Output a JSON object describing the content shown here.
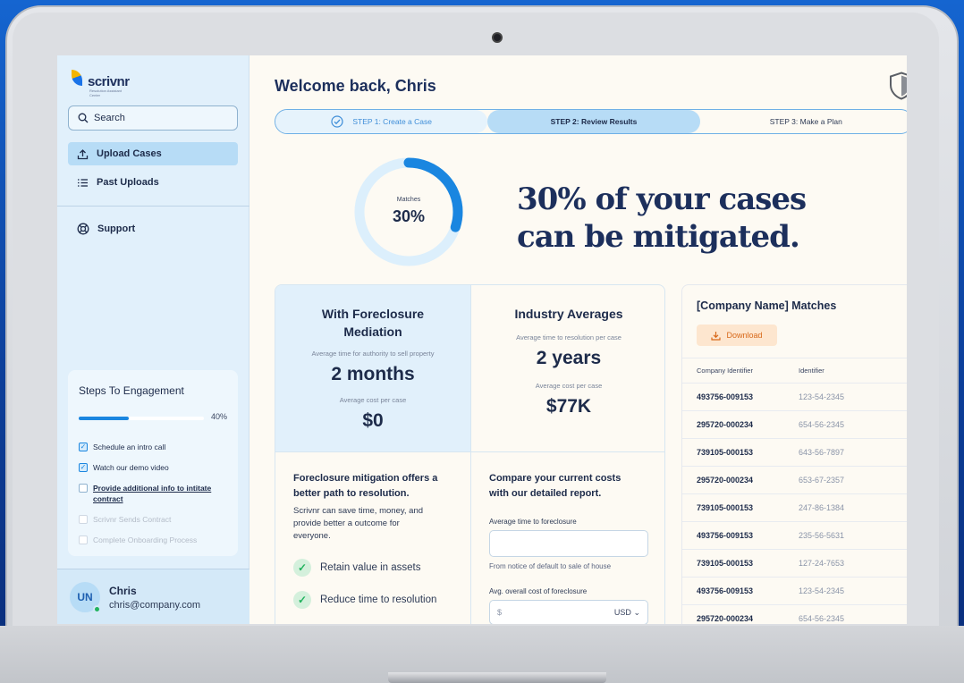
{
  "brand": {
    "name": "scrivnr",
    "tagline": "Resolution Assistant Center"
  },
  "sidebar": {
    "search_label": "Search",
    "items": [
      {
        "label": "Upload Cases",
        "icon": "upload-icon",
        "active": true
      },
      {
        "label": "Past Uploads",
        "icon": "list-icon",
        "active": false
      },
      {
        "label": "Support",
        "icon": "lifebuoy-icon",
        "active": false
      }
    ],
    "steps": {
      "title": "Steps To Engagement",
      "progress": 0.4,
      "progress_label": "40%",
      "items": [
        {
          "label": "Schedule an intro call",
          "state": "done"
        },
        {
          "label": "Watch our demo video",
          "state": "done"
        },
        {
          "label": "Provide additional info to intitate contract",
          "state": "current"
        },
        {
          "label": "Scrivnr Sends Contract",
          "state": "pending"
        },
        {
          "label": "Complete Onboarding Process",
          "state": "pending"
        }
      ]
    },
    "user": {
      "initials": "UN",
      "name": "Chris",
      "email": "chris@company.com"
    }
  },
  "header": {
    "welcome": "Welcome back, Chris"
  },
  "stepper": {
    "steps": [
      "STEP 1: Create a Case",
      "STEP 2: Review Results",
      "STEP 3: Make a Plan"
    ],
    "active": 1
  },
  "summary": {
    "donut_label": "Matches",
    "donut_value": "30%",
    "donut_fraction": 0.3,
    "headline_line1": "30% of your cases",
    "headline_line2": "can be mitigated."
  },
  "metrics": {
    "mediation": {
      "title_line1": "With Foreclosure",
      "title_line2": "Mediation",
      "time_label": "Average time for authority to sell property",
      "time_value": "2 months",
      "cost_label": "Average cost per case",
      "cost_value": "$0"
    },
    "industry": {
      "title": "Industry Averages",
      "time_label": "Average time to resolution per case",
      "time_value": "2 years",
      "cost_label": "Average cost per case",
      "cost_value": "$77K"
    },
    "pitch": {
      "title_line1": "Foreclosure mitigation offers a",
      "title_line2": "better path to resolution.",
      "text_line1": "Scrivnr can save time, money, and",
      "text_line2": "provide better a outcome for",
      "text_line3": "everyone.",
      "benefits": [
        "Retain value in assets",
        "Reduce time to resolution"
      ]
    },
    "compare": {
      "title_line1": "Compare your current costs",
      "title_line2": "with our detailed report.",
      "field1_label": "Average time to foreclosure",
      "field1_hint": "From notice of default to sale of house",
      "field2_label": "Avg. overall cost of foreclosure",
      "field2_symbol": "$",
      "field2_currency": "USD"
    }
  },
  "matches": {
    "title": "[Company Name] Matches",
    "download_label": "Download",
    "columns": [
      "Company Identifier",
      "Identifier"
    ],
    "rows": [
      [
        "493756-009153",
        "123-54-2345"
      ],
      [
        "295720-000234",
        "654-56-2345"
      ],
      [
        "739105-000153",
        "643-56-7897"
      ],
      [
        "295720-000234",
        "653-67-2357"
      ],
      [
        "739105-000153",
        "247-86-1384"
      ],
      [
        "493756-009153",
        "235-56-5631"
      ],
      [
        "739105-000153",
        "127-24-7653"
      ],
      [
        "493756-009153",
        "123-54-2345"
      ],
      [
        "295720-000234",
        "654-56-2345"
      ]
    ]
  },
  "colors": {
    "accent": "#1a86e0",
    "sidebar_bg": "#e1f0fb",
    "active_step": "#b7dcf6",
    "download_bg": "#fde6cf",
    "download_fg": "#d8691a",
    "success": "#22b35e"
  }
}
